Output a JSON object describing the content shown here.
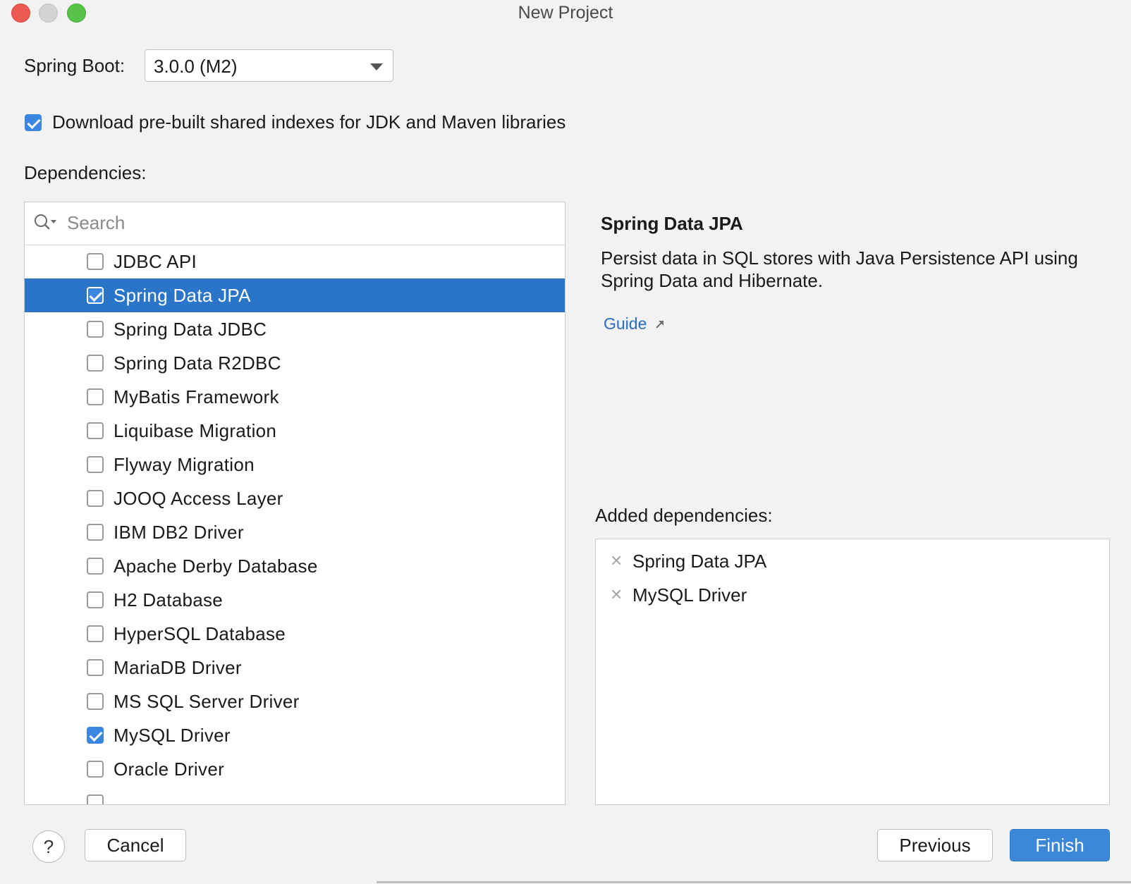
{
  "window": {
    "title": "New Project"
  },
  "spring_boot": {
    "label": "Spring Boot:",
    "value": "3.0.0 (M2)"
  },
  "download_indexes": {
    "checked": true,
    "label": "Download pre-built shared indexes for JDK and Maven libraries"
  },
  "dependencies": {
    "label": "Dependencies:",
    "search_placeholder": "Search",
    "items": [
      {
        "label": "JDBC API",
        "checked": false,
        "selected": false
      },
      {
        "label": "Spring Data JPA",
        "checked": true,
        "selected": true
      },
      {
        "label": "Spring Data JDBC",
        "checked": false,
        "selected": false
      },
      {
        "label": "Spring Data R2DBC",
        "checked": false,
        "selected": false
      },
      {
        "label": "MyBatis Framework",
        "checked": false,
        "selected": false
      },
      {
        "label": "Liquibase Migration",
        "checked": false,
        "selected": false
      },
      {
        "label": "Flyway Migration",
        "checked": false,
        "selected": false
      },
      {
        "label": "JOOQ Access Layer",
        "checked": false,
        "selected": false
      },
      {
        "label": "IBM DB2 Driver",
        "checked": false,
        "selected": false
      },
      {
        "label": "Apache Derby Database",
        "checked": false,
        "selected": false
      },
      {
        "label": "H2 Database",
        "checked": false,
        "selected": false
      },
      {
        "label": "HyperSQL Database",
        "checked": false,
        "selected": false
      },
      {
        "label": "MariaDB Driver",
        "checked": false,
        "selected": false
      },
      {
        "label": "MS SQL Server Driver",
        "checked": false,
        "selected": false
      },
      {
        "label": "MySQL Driver",
        "checked": true,
        "selected": false
      },
      {
        "label": "Oracle Driver",
        "checked": false,
        "selected": false
      }
    ]
  },
  "details": {
    "title": "Spring Data JPA",
    "description": "Persist data in SQL stores with Java Persistence API using Spring Data and Hibernate.",
    "guide_link": "Guide"
  },
  "added": {
    "label": "Added dependencies:",
    "items": [
      "Spring Data JPA",
      "MySQL Driver"
    ]
  },
  "buttons": {
    "help": "?",
    "cancel": "Cancel",
    "previous": "Previous",
    "finish": "Finish"
  },
  "colors": {
    "accent": "#3b86e0",
    "selection": "#2a75c8",
    "link": "#2b6cc4"
  }
}
